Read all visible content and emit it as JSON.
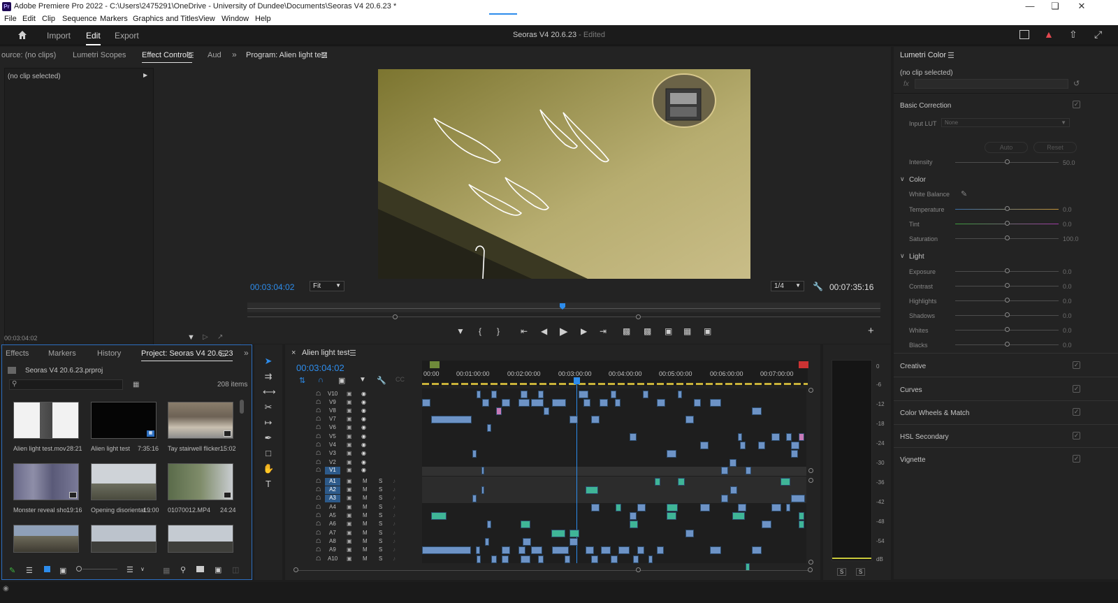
{
  "window": {
    "title": "Adobe Premiere Pro 2022 - C:\\Users\\2475291\\OneDrive - University of Dundee\\Documents\\Seoras V4 20.6.23 *",
    "app_icon": "Pr"
  },
  "menu": [
    "File",
    "Edit",
    "Clip",
    "Sequence",
    "Markers",
    "Graphics and Titles",
    "View",
    "Window",
    "Help"
  ],
  "workspace": {
    "tabs": [
      "Import",
      "Edit",
      "Export"
    ],
    "active": "Edit",
    "document_title": "Seoras V4 20.6.23",
    "document_status": "- Edited"
  },
  "source_panel": {
    "tabs": [
      "ource: (no clips)",
      "Lumetri Scopes",
      "Effect Controls",
      "Aud"
    ],
    "active_tab": "Effect Controls",
    "clip_label": "(no clip selected)",
    "timecode": "00:03:04:02"
  },
  "program_monitor": {
    "tab": "Program: Alien light test",
    "timecode": "00:03:04:02",
    "fit": "Fit",
    "resolution": "1/4",
    "duration": "00:07:35:16"
  },
  "lumetri": {
    "title": "Lumetri Color",
    "clip": "(no clip selected)",
    "fx_label": "fx",
    "basic_correction": "Basic Correction",
    "input_lut_label": "Input LUT",
    "input_lut_value": "None",
    "auto_label": "Auto",
    "reset_label": "Reset",
    "intensity_label": "Intensity",
    "intensity_value": "50.0",
    "color_section": "Color",
    "white_balance": "White Balance",
    "color_rows": [
      {
        "label": "Temperature",
        "value": "0.0"
      },
      {
        "label": "Tint",
        "value": "0.0"
      },
      {
        "label": "Saturation",
        "value": "100.0"
      }
    ],
    "light_section": "Light",
    "light_rows": [
      {
        "label": "Exposure",
        "value": "0.0"
      },
      {
        "label": "Contrast",
        "value": "0.0"
      },
      {
        "label": "Highlights",
        "value": "0.0"
      },
      {
        "label": "Shadows",
        "value": "0.0"
      },
      {
        "label": "Whites",
        "value": "0.0"
      },
      {
        "label": "Blacks",
        "value": "0.0"
      }
    ],
    "sections": [
      "Creative",
      "Curves",
      "Color Wheels & Match",
      "HSL Secondary",
      "Vignette"
    ]
  },
  "project_panel": {
    "tabs": [
      "Effects",
      "Markers",
      "History",
      "Project: Seoras V4 20.6.23"
    ],
    "active_tab": "Project: Seoras V4 20.6.23",
    "file": "Seoras V4 20.6.23.prproj",
    "item_count": "208 items",
    "items": [
      {
        "name": "Alien light test.mov",
        "duration": "28:21"
      },
      {
        "name": "Alien light test",
        "duration": "7:35:16"
      },
      {
        "name": "Tay stairwell flicker...",
        "duration": "15:02"
      },
      {
        "name": "Monster reveal sho...",
        "duration": "19:16"
      },
      {
        "name": "Opening disorientat...",
        "duration": "19:00"
      },
      {
        "name": "01070012.MP4",
        "duration": "24:24"
      }
    ]
  },
  "timeline": {
    "tab": "Alien light test",
    "timecode": "00:03:04:02",
    "ruler": [
      "00:00",
      "00:01:00:00",
      "00:02:00:00",
      "00:03:00:00",
      "00:04:00:00",
      "00:05:00:00",
      "00:06:00:00",
      "00:07:00:00"
    ],
    "video_tracks": [
      "V10",
      "V9",
      "V8",
      "V7",
      "V6",
      "V5",
      "V4",
      "V3",
      "V2",
      "V1"
    ],
    "audio_tracks": [
      "A1",
      "A2",
      "A3",
      "A4",
      "A5",
      "A6",
      "A7",
      "A8",
      "A9",
      "A10"
    ],
    "mute": "M",
    "solo": "S"
  },
  "audio_meter": {
    "scale": [
      "0",
      "-6",
      "-12",
      "-18",
      "-24",
      "-30",
      "-36",
      "-42",
      "-48",
      "-54",
      "dB"
    ],
    "solo_buttons": [
      "S",
      "S"
    ]
  },
  "colors": {
    "accent_blue": "#2d8ceb",
    "clip_video": "#6d93c6",
    "clip_audio": "#3fb597",
    "clip_pink": "#c87ab8",
    "panel": "#232323"
  }
}
